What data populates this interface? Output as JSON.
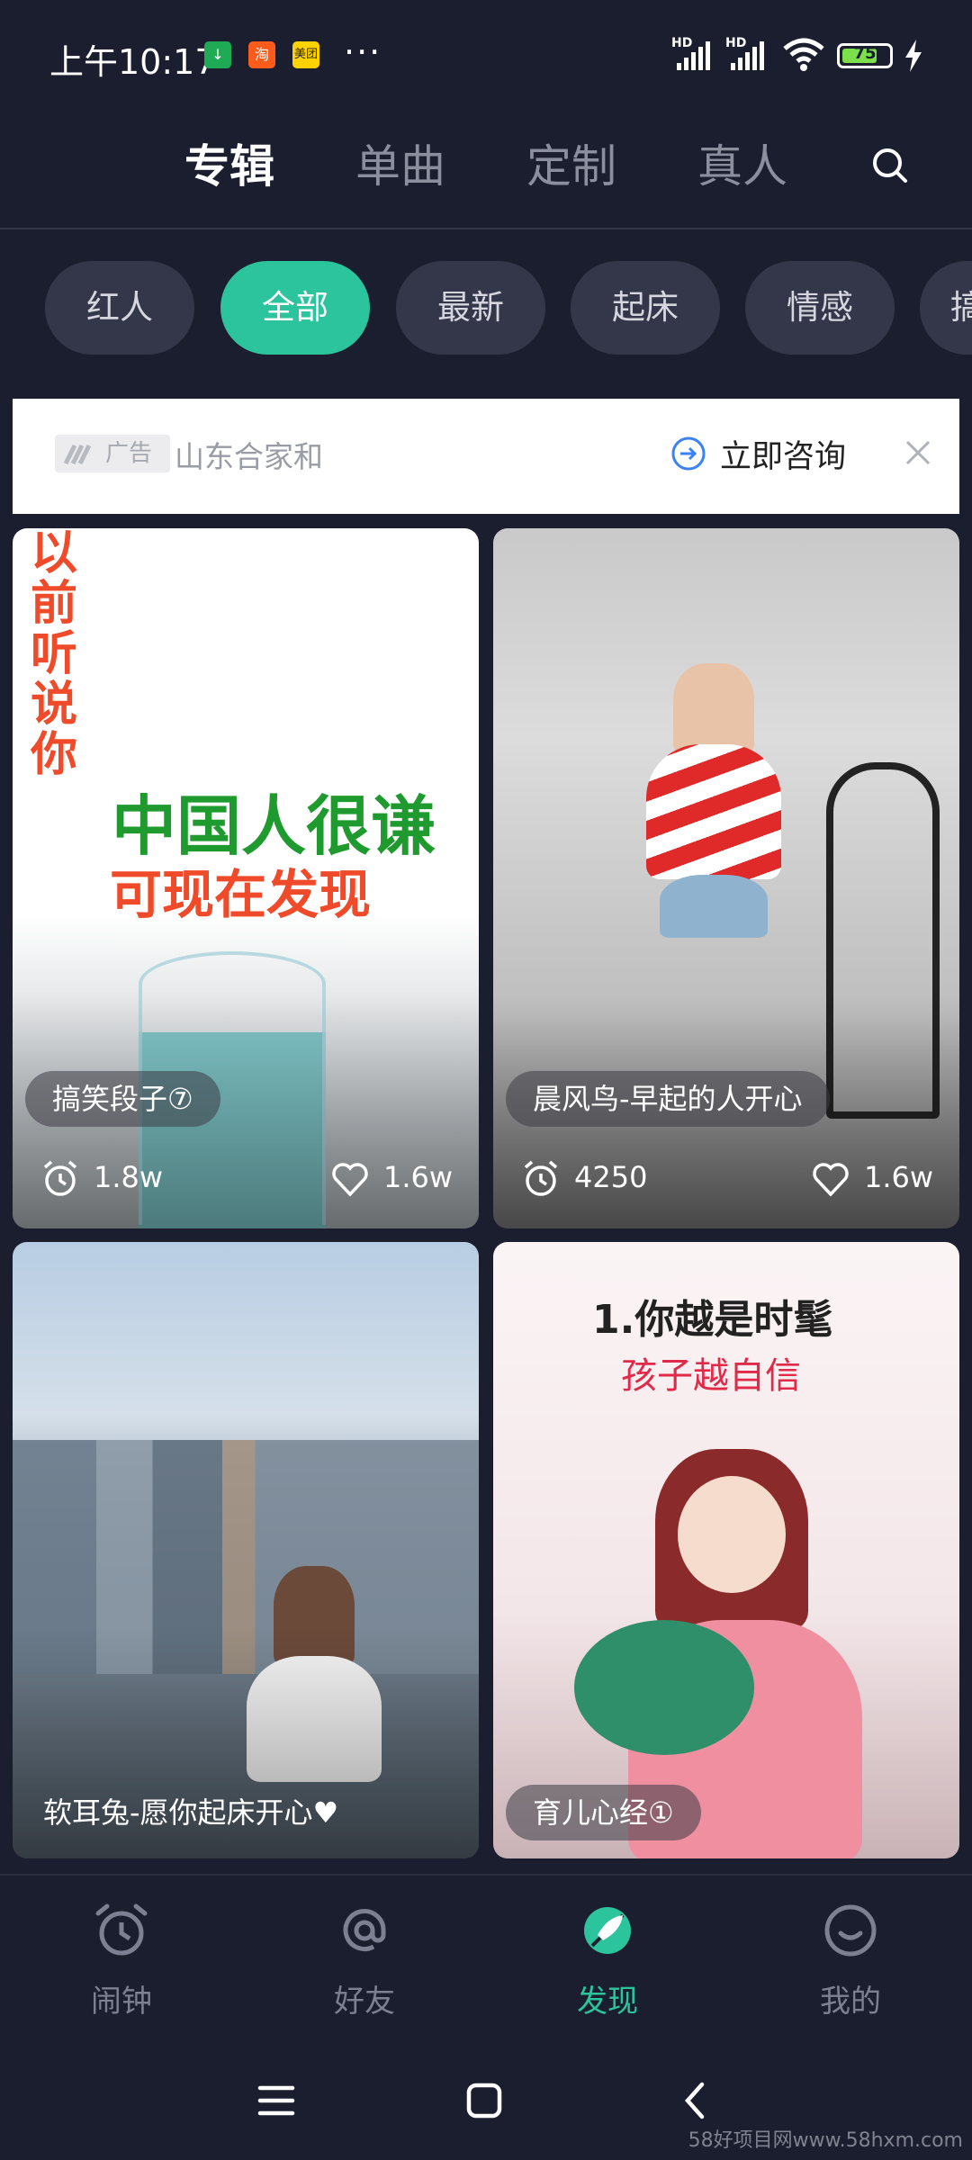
{
  "status_bar": {
    "time": "上午10:17",
    "dots": "···",
    "signal1_label": "HD",
    "signal2_label": "HD",
    "battery": "75",
    "battery_level": 0.75
  },
  "tabs": [
    "专辑",
    "单曲",
    "定制",
    "真人"
  ],
  "chips": [
    "红人",
    "全部",
    "最新",
    "起床",
    "情感",
    "搞"
  ],
  "ad": {
    "badge": "广告",
    "advertiser": "山东合家和",
    "cta": "立即咨询"
  },
  "cards": [
    {
      "title": "搞笑段子⑦",
      "plays": "1.8w",
      "likes": "1.6w",
      "art_vertical": "以前听说你",
      "art_headline": "中国人很谦",
      "art_subhead": "可现在发现"
    },
    {
      "title": "晨风鸟-早起的人开心",
      "plays": "4250",
      "likes": "1.6w"
    },
    {
      "title": "软耳兔-愿你起床开心♥"
    },
    {
      "title": "育儿心经①",
      "art_headline": "1.你越是时髦",
      "art_subhead": "孩子越自信"
    }
  ],
  "nav": [
    "闹钟",
    "好友",
    "发现",
    "我的"
  ],
  "watermark": "58好项目网www.58hxm.com",
  "colors": {
    "background": "#1b1e2e",
    "accent": "#2bc49d",
    "inactive": "#8b8e9d"
  },
  "icons": {
    "status": [
      "download-icon",
      "taobao-icon",
      "meituan-icon",
      "signal-icon",
      "wifi-icon",
      "battery-icon",
      "charging-icon"
    ],
    "tabs": [
      "search-icon"
    ],
    "cards": [
      "alarm-icon",
      "heart-icon"
    ],
    "nav": [
      "alarm-clock-icon",
      "at-icon",
      "discover-icon",
      "smile-icon"
    ],
    "system": [
      "menu-icon",
      "home-icon",
      "back-icon"
    ]
  }
}
